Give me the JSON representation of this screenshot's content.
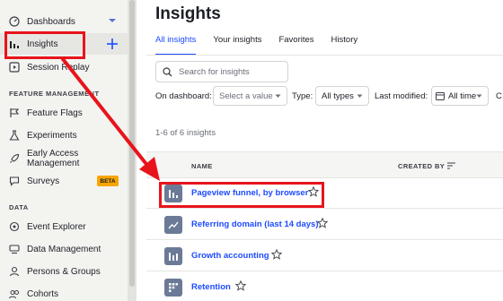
{
  "sidebar": {
    "items": [
      {
        "label": "Dashboards",
        "icon": "gauge-icon"
      },
      {
        "label": "Insights",
        "icon": "bar-chart-icon"
      },
      {
        "label": "Session Replay",
        "icon": "play-square-icon"
      },
      {
        "label": "Feature Flags",
        "icon": "flag-icon"
      },
      {
        "label": "Experiments",
        "icon": "flask-icon"
      },
      {
        "label": "Early Access Management",
        "icon": "rocket-icon"
      },
      {
        "label": "Surveys",
        "icon": "chat-icon"
      },
      {
        "label": "Event Explorer",
        "icon": "event-icon"
      },
      {
        "label": "Data Management",
        "icon": "server-icon"
      },
      {
        "label": "Persons & Groups",
        "icon": "persons-icon"
      },
      {
        "label": "Cohorts",
        "icon": "cohorts-icon"
      }
    ],
    "sections": {
      "feature_management": "FEATURE MANAGEMENT",
      "data": "DATA"
    },
    "beta_badge": "BETA"
  },
  "page": {
    "title": "Insights"
  },
  "tabs": [
    "All insights",
    "Your insights",
    "Favorites",
    "History"
  ],
  "search": {
    "placeholder": "Search for insights"
  },
  "filters": {
    "dashboard_label": "On dashboard:",
    "dashboard_value": "Select a value",
    "type_label": "Type:",
    "type_value": "All types",
    "modified_label": "Last modified:",
    "modified_value": "All time",
    "cutoff_label": "C"
  },
  "results": {
    "count_text": "1-6 of 6 insights"
  },
  "table": {
    "columns": {
      "name": "NAME",
      "created_by": "CREATED BY"
    },
    "rows": [
      {
        "name": "Pageview funnel, by browser",
        "icon": "funnel-bars-icon"
      },
      {
        "name": "Referring domain (last 14 days)",
        "icon": "trend-line-icon"
      },
      {
        "name": "Growth accounting",
        "icon": "stacked-bars-icon"
      },
      {
        "name": "Retention",
        "icon": "grid-icon"
      }
    ]
  },
  "colors": {
    "accent": "#1d4aff",
    "annotation": "#e8141b",
    "beta": "#f7a501",
    "sidebar_bg": "#f3f4f0"
  }
}
